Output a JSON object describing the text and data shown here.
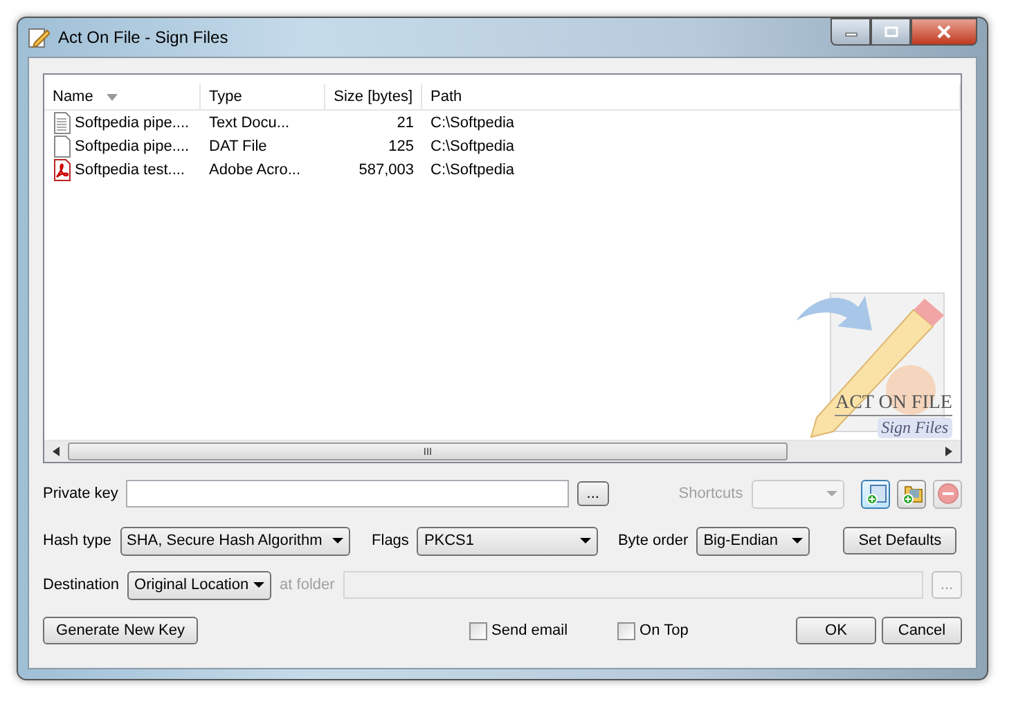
{
  "window": {
    "title": "Act On File - Sign Files"
  },
  "list": {
    "columns": [
      {
        "label": "Name",
        "sorted": true
      },
      {
        "label": "Type",
        "sorted": false
      },
      {
        "label": "Size [bytes]",
        "sorted": false
      },
      {
        "label": "Path",
        "sorted": false
      }
    ],
    "rows": [
      {
        "kind": "text",
        "name": "Softpedia pipe....",
        "type": "Text Docu...",
        "size": "21",
        "path": "C:\\Softpedia"
      },
      {
        "kind": "blank",
        "name": "Softpedia pipe....",
        "type": "DAT File",
        "size": "125",
        "path": "C:\\Softpedia"
      },
      {
        "kind": "pdf",
        "name": "Softpedia test....",
        "type": "Adobe Acro...",
        "size": "587,003",
        "path": "C:\\Softpedia"
      }
    ],
    "logo": {
      "title": "ACT ON FILE",
      "subtitle": "Sign Files"
    },
    "scroll_grip": "III"
  },
  "private_key": {
    "label": "Private key",
    "browse": "..."
  },
  "shortcuts": {
    "label": "Shortcuts",
    "disabled": true
  },
  "tool_buttons": [
    {
      "kind": "add-file",
      "disabled": false,
      "selected": true
    },
    {
      "kind": "add-folder",
      "disabled": false,
      "selected": false
    },
    {
      "kind": "remove",
      "disabled": true,
      "selected": false
    }
  ],
  "hash_type": {
    "label": "Hash type",
    "value": "SHA, Secure Hash Algorithm"
  },
  "flags": {
    "label": "Flags",
    "value": "PKCS1"
  },
  "byte_order": {
    "label": "Byte order",
    "value": "Big-Endian"
  },
  "set_defaults": "Set Defaults",
  "destination": {
    "label": "Destination",
    "value": "Original Location"
  },
  "at_folder": {
    "label": "at folder",
    "disabled": true,
    "browse": "..."
  },
  "generate_button": "Generate New Key",
  "send_email": {
    "label": "Send email",
    "checked": false
  },
  "on_top": {
    "label": "On Top",
    "checked": false
  },
  "buttons": [
    "OK",
    "Cancel"
  ]
}
